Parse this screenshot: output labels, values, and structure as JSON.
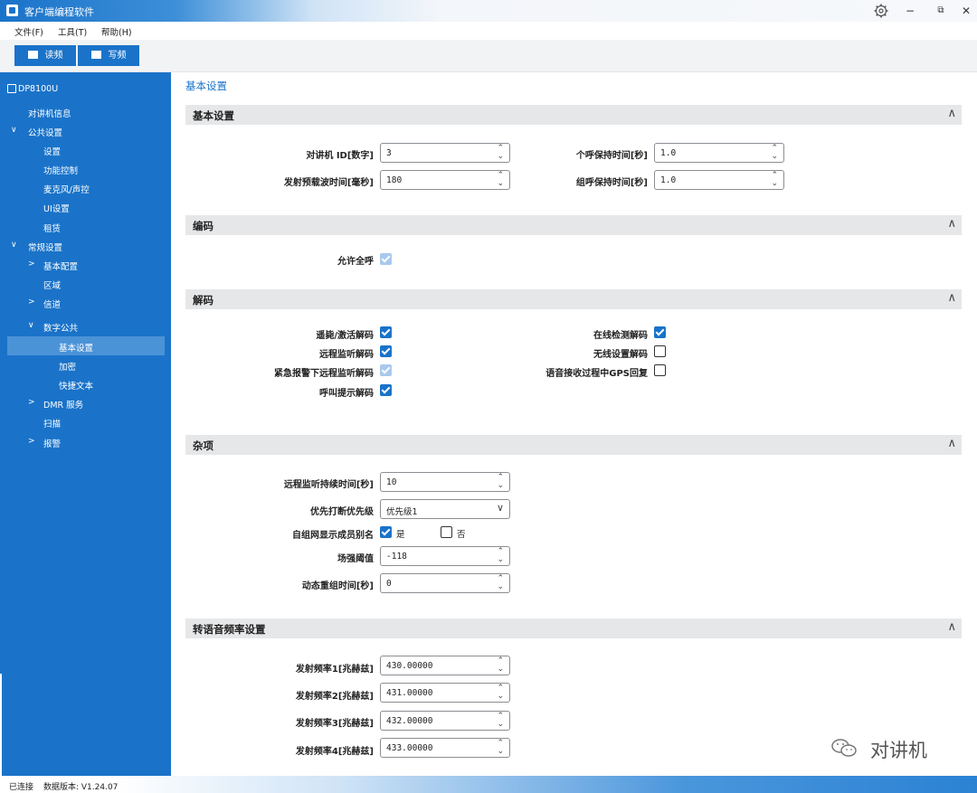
{
  "window": {
    "title": "客户端编程软件",
    "minimize": "−",
    "restore": "⧉",
    "close": "✕"
  },
  "menu": [
    "文件(F)",
    "工具(T)",
    "帮助(H)"
  ],
  "toolbar": {
    "read": "读频",
    "write": "写频"
  },
  "sidebar": {
    "device": "DP8100U",
    "items": [
      {
        "label": "对讲机信息"
      },
      {
        "label": "公共设置",
        "chev": "∨"
      },
      {
        "label": "设置"
      },
      {
        "label": "功能控制"
      },
      {
        "label": "麦克风/声控"
      },
      {
        "label": "UI设置"
      },
      {
        "label": "租赁"
      },
      {
        "label": "常规设置",
        "chev": "∨"
      },
      {
        "label": "基本配置",
        "chev": ">"
      },
      {
        "label": "区域"
      },
      {
        "label": "信道",
        "chev": ">"
      },
      {
        "label": "数字公共",
        "chev": "∨"
      },
      {
        "label": "基本设置"
      },
      {
        "label": "加密"
      },
      {
        "label": "快捷文本"
      },
      {
        "label": "DMR 服务",
        "chev": ">"
      },
      {
        "label": "扫描"
      },
      {
        "label": "报警",
        "chev": ">"
      }
    ]
  },
  "page_title": "基本设置",
  "sections": {
    "basic": "基本设置",
    "encode": "编码",
    "decode": "解码",
    "misc": "杂项",
    "voice": "转语音频率设置",
    "caret": "∧"
  },
  "basic": {
    "radio_id_label": "对讲机 ID[数字]",
    "radio_id": "3",
    "preamble_label": "发射预载波时间[毫秒]",
    "preamble": "180",
    "private_hold_label": "个呼保持时间[秒]",
    "private_hold": "1.0",
    "group_hold_label": "组呼保持时间[秒]",
    "group_hold": "1.0"
  },
  "encode": {
    "all_call_label": "允许全呼"
  },
  "decode": {
    "stun_label": "遥毙/激活解码",
    "remote_monitor_label": "远程监听解码",
    "emergency_label": "紧急报警下远程监听解码",
    "call_alert_label": "呼叫提示解码",
    "online_check_label": "在线检测解码",
    "wireless_label": "无线设置解码",
    "gps_label": "语音接收过程中GPS回复"
  },
  "misc": {
    "monitor_duration_label": "远程监听持续时间[秒]",
    "monitor_duration": "10",
    "priority_label": "优先打断优先级",
    "priority": "优先级1",
    "alias_label": "自组网显示成员别名",
    "yes": "是",
    "no": "否",
    "rssi_label": "场强阈值",
    "rssi": "-118",
    "regroup_label": "动态重组时间[秒]",
    "regroup": "0"
  },
  "voice": {
    "freqs": [
      {
        "label": "发射频率1[兆赫兹]",
        "value": "430.00000"
      },
      {
        "label": "发射频率2[兆赫兹]",
        "value": "431.00000"
      },
      {
        "label": "发射频率3[兆赫兹]",
        "value": "432.00000"
      },
      {
        "label": "发射频率4[兆赫兹]",
        "value": "433.00000"
      }
    ]
  },
  "spin_arrows": "⌃⌄",
  "combo_arrow": "∨",
  "status": {
    "connected": "已连接",
    "data_version": "数据版本: V1.24.07"
  },
  "watermark": "对讲机"
}
